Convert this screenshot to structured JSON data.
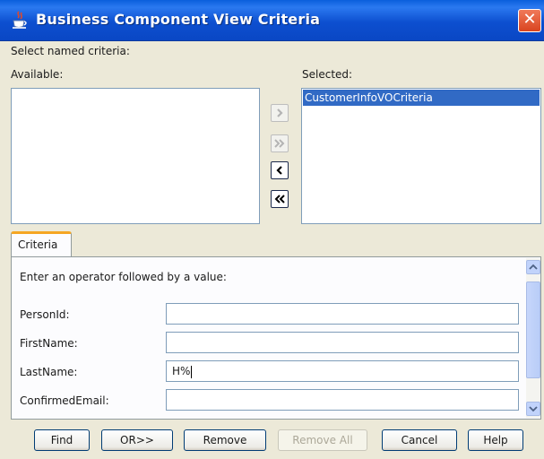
{
  "window": {
    "title": "Business Component View Criteria",
    "close_glyph": "✕",
    "title_icon": "java-cup-icon"
  },
  "named_criteria": {
    "heading": "Select named criteria:",
    "available_label": "Available:",
    "selected_label": "Selected:",
    "available_items": [],
    "selected_items": [
      "CustomerInfoVOCriteria"
    ],
    "shuttle": {
      "move_right": "›",
      "move_all_right": "»",
      "move_left": "‹",
      "move_all_left": "«"
    }
  },
  "tabs": [
    {
      "label": "Criteria",
      "selected": true
    }
  ],
  "criteria": {
    "instruction": "Enter an operator followed by a value:",
    "fields": [
      {
        "label": "PersonId:",
        "value": ""
      },
      {
        "label": "FirstName:",
        "value": ""
      },
      {
        "label": "LastName:",
        "value": "H%"
      },
      {
        "label": "ConfirmedEmail:",
        "value": ""
      }
    ]
  },
  "buttons": {
    "find": "Find",
    "or": "OR>>",
    "remove": "Remove",
    "remove_all": "Remove All",
    "cancel": "Cancel",
    "help": "Help"
  },
  "colors": {
    "titlebar": "#0a47c4",
    "selection": "#316ac5",
    "tab_accent": "#f5a623",
    "dialog_bg": "#ece9d8"
  }
}
